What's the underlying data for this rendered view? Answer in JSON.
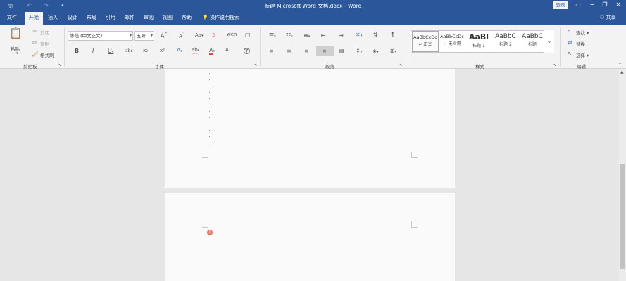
{
  "titlebar": {
    "title": "新建 Microsoft Word 文档.docx - Word",
    "login": "登录",
    "save_icon": "save-icon",
    "undo_icon": "undo-icon",
    "redo_icon": "redo-icon",
    "customize_icon": "customize-qat-icon"
  },
  "tabs": [
    "文件",
    "开始",
    "插入",
    "设计",
    "布局",
    "引用",
    "邮件",
    "审阅",
    "视图",
    "帮助"
  ],
  "tell_me": "操作说明搜索",
  "share": "共享",
  "clipboard": {
    "paste": "粘贴",
    "cut": "剪切",
    "copy": "复制",
    "format_painter": "格式刷",
    "label": "剪贴板"
  },
  "font": {
    "name": "等线 (中文正文)",
    "size": "五号",
    "label": "字体",
    "bold": "B",
    "italic": "I",
    "underline": "U",
    "strike": "abc",
    "subscript": "x₂",
    "superscript": "x²",
    "grow": "A",
    "shrink": "A",
    "change_case": "Aa",
    "highlight": "ab",
    "font_color": "A",
    "text_effect": "A",
    "phonetic": "wén",
    "enclose": "字",
    "clear": "A",
    "accent_red": "#e04a3b",
    "accent_yellow": "#f3e03b"
  },
  "paragraph": {
    "label": "段落"
  },
  "styles": {
    "label": "样式",
    "items": [
      {
        "preview": "AaBbCcDc",
        "name": "↵ 正文"
      },
      {
        "preview": "AaBbCcDc",
        "name": "↵ 无间隔"
      },
      {
        "preview": "AaBl",
        "name": "标题 1"
      },
      {
        "preview": "AaBbC",
        "name": "标题 2"
      },
      {
        "preview": "AaBbC",
        "name": "标题"
      }
    ]
  },
  "editing": {
    "find": "查找",
    "replace": "替换",
    "select": "选择",
    "label": "编辑"
  }
}
